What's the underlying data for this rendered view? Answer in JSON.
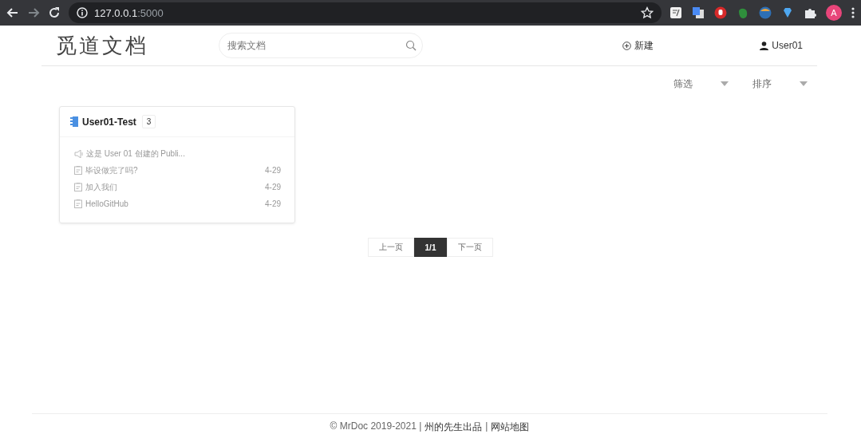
{
  "browser": {
    "url_host": "127.0.0.1",
    "url_port": ":5000",
    "avatar": "A"
  },
  "header": {
    "logo": "觅道文档",
    "search": {
      "placeholder": "搜索文档"
    },
    "new_button": "新建",
    "user": "User01"
  },
  "toolbar": {
    "dropdowns": [
      "筛选",
      "排序"
    ]
  },
  "projects": [
    {
      "name": "User01-Test",
      "count": "3",
      "items": [
        {
          "kind": "notice",
          "title": "这是 User 01 创建的 Publi..."
        },
        {
          "kind": "doc",
          "title": "毕设做完了吗?",
          "date": "4-29"
        },
        {
          "kind": "doc",
          "title": "加入我们",
          "date": "4-29"
        },
        {
          "kind": "doc",
          "title": "HelloGitHub",
          "date": "4-29"
        }
      ]
    }
  ],
  "pagination": {
    "prev": "上一页",
    "current": "1/1",
    "next": "下一页"
  },
  "footer": [
    {
      "kind": "text",
      "text": "© MrDoc 2019-2021 |"
    },
    {
      "kind": "link",
      "text": "州的先生出品"
    },
    {
      "kind": "text",
      "text": "|"
    },
    {
      "kind": "link",
      "text": "网站地图"
    }
  ]
}
